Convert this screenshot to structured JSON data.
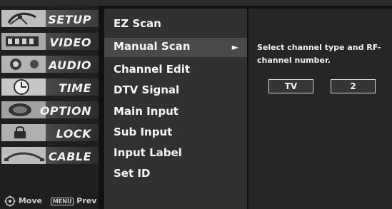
{
  "sidebar": {
    "tabs": [
      {
        "label": "SETUP",
        "icon": "satellite-dish-icon",
        "selected": true
      },
      {
        "label": "VIDEO",
        "icon": "film-strip-icon",
        "selected": false
      },
      {
        "label": "AUDIO",
        "icon": "speaker-icon",
        "selected": false
      },
      {
        "label": "TIME",
        "icon": "clock-icon",
        "selected": false
      },
      {
        "label": "OPTION",
        "icon": "option-tag-icon",
        "selected": false
      },
      {
        "label": "LOCK",
        "icon": "lock-icon",
        "selected": false
      },
      {
        "label": "CABLE",
        "icon": "cable-icon",
        "selected": false
      }
    ],
    "hints": {
      "move": "Move",
      "prev": "Prev",
      "menu_badge": "MENU"
    }
  },
  "menu": {
    "items": [
      {
        "label": "EZ Scan",
        "selected": false
      },
      {
        "label": "Manual Scan",
        "selected": true,
        "arrow": "►"
      },
      {
        "label": "Channel Edit",
        "selected": false
      },
      {
        "label": "DTV Signal",
        "selected": false
      },
      {
        "label": "Main Input",
        "selected": false
      },
      {
        "label": "Sub Input",
        "selected": false
      },
      {
        "label": "Input Label",
        "selected": false
      },
      {
        "label": "Set ID",
        "selected": false
      }
    ]
  },
  "info": {
    "description": "Select channel type and RF-channel number.",
    "type_value": "TV",
    "number_value": "2"
  },
  "colors": {
    "menu_bg": "#313131",
    "selected_bg": "#4a4a4a",
    "info_bg": "#262626",
    "text": "#f7f7f7"
  }
}
